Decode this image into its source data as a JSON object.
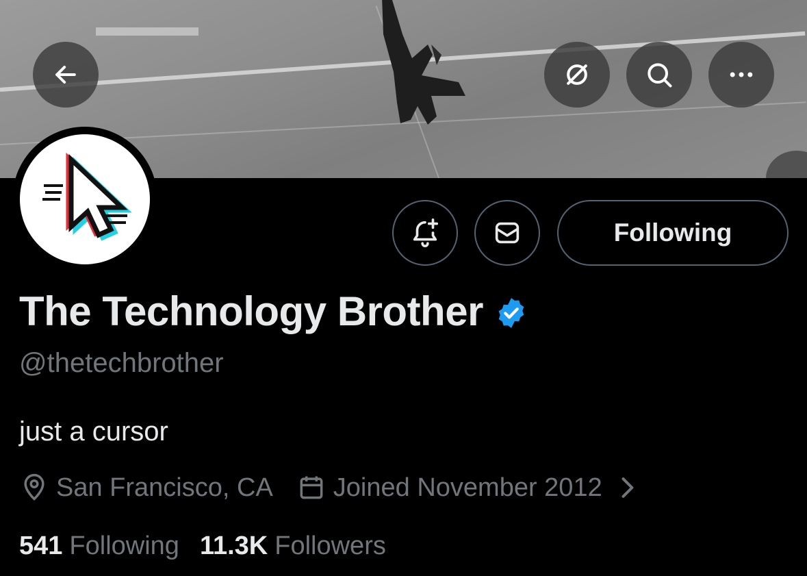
{
  "header": {
    "back_icon": "arrow-left-icon",
    "grok_icon": "grok-icon",
    "search_icon": "search-icon",
    "more_icon": "more-horizontal-icon"
  },
  "profile": {
    "name": "The Technology Brother",
    "verified": true,
    "verified_color": "#1d9bf0",
    "handle": "@thetechbrother",
    "bio": "just a cursor",
    "location": "San Francisco, CA",
    "joined": "Joined November 2012",
    "following_count": "541",
    "following_label": "Following",
    "followers_count": "11.3K",
    "followers_label": "Followers"
  },
  "actions": {
    "notify_icon": "bell-plus-icon",
    "message_icon": "mail-icon",
    "following_button_label": "Following"
  },
  "colors": {
    "background": "#000000",
    "primary_text": "#e7e9ea",
    "secondary_text": "#71767b",
    "border": "#536471"
  }
}
